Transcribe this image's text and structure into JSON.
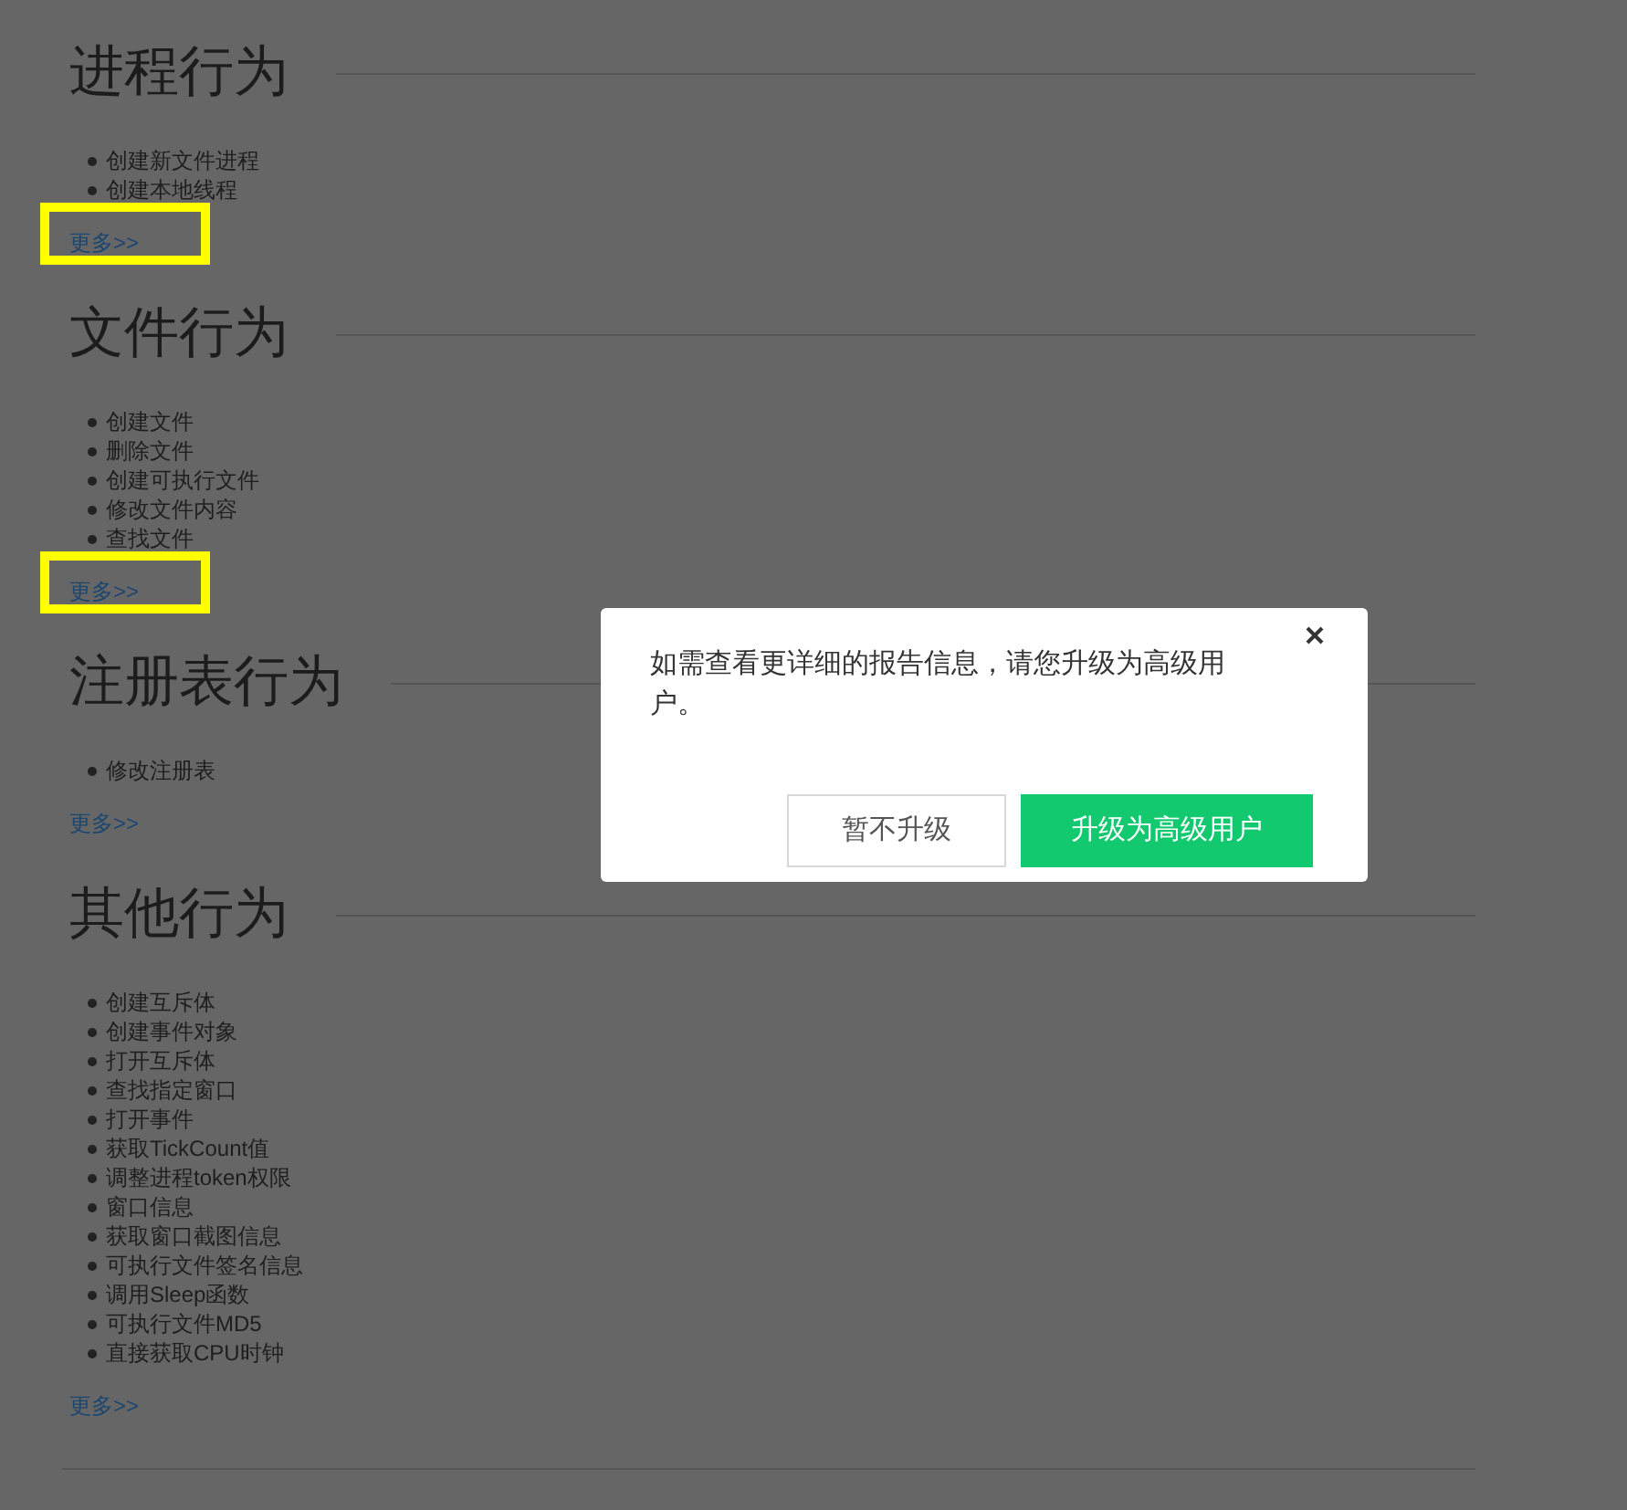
{
  "sections": [
    {
      "title": "进程行为",
      "items": [
        "创建新文件进程",
        "创建本地线程"
      ],
      "more": {
        "label": "更多>>",
        "highlighted": true
      }
    },
    {
      "title": "文件行为",
      "items": [
        "创建文件",
        "删除文件",
        "创建可执行文件",
        "修改文件内容",
        "查找文件"
      ],
      "more": {
        "label": "更多>>",
        "highlighted": true
      }
    },
    {
      "title": "注册表行为",
      "items": [
        "修改注册表"
      ],
      "more": {
        "label": "更多>>",
        "highlighted": false
      }
    },
    {
      "title": "其他行为",
      "items": [
        "创建互斥体",
        "创建事件对象",
        "打开互斥体",
        "查找指定窗口",
        "打开事件",
        "获取TickCount值",
        "调整进程token权限",
        "窗口信息",
        "获取窗口截图信息",
        "可执行文件签名信息",
        "调用Sleep函数",
        "可执行文件MD5",
        "直接获取CPU时钟"
      ],
      "more": {
        "label": "更多>>",
        "highlighted": false
      }
    }
  ],
  "dialog": {
    "message": "如需查看更详细的报告信息，请您升级为高级用户。",
    "buttons": [
      {
        "label": "暂不升级",
        "kind": "secondary"
      },
      {
        "label": "升级为高级用户",
        "kind": "primary"
      }
    ]
  }
}
